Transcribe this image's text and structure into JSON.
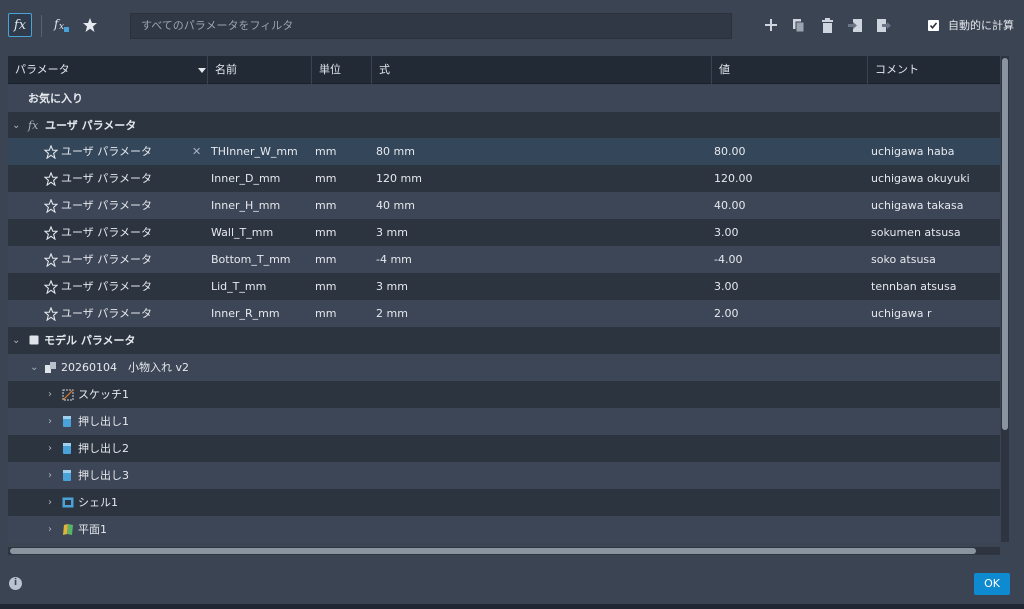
{
  "toolbar": {
    "fx_label": "fx",
    "filter_placeholder": "すべてのパラメータをフィルタ",
    "auto_compute_label": "自動的に計算",
    "auto_compute_checked": true,
    "icons": [
      "fx-icon",
      "add-favorite-parameter-icon",
      "star-icon",
      "add-icon",
      "copy-icon",
      "delete-icon",
      "import-icon",
      "export-icon"
    ]
  },
  "table": {
    "columns": [
      "パラメータ",
      "名前",
      "単位",
      "式",
      "値",
      "コメント"
    ],
    "favorites_label": "お気に入り",
    "user_params_label": "ユーザ パラメータ",
    "rows": [
      {
        "param": "ユーザ パラメータ",
        "name": "THInner_W_mm",
        "unit": "mm",
        "expr": "80 mm",
        "value": "80.00",
        "comment": "uchigawa haba"
      },
      {
        "param": "ユーザ パラメータ",
        "name": "Inner_D_mm",
        "unit": "mm",
        "expr": "120 mm",
        "value": "120.00",
        "comment": "uchigawa okuyuki"
      },
      {
        "param": "ユーザ パラメータ",
        "name": "Inner_H_mm",
        "unit": "mm",
        "expr": "40 mm",
        "value": "40.00",
        "comment": "uchigawa takasa"
      },
      {
        "param": "ユーザ パラメータ",
        "name": "Wall_T_mm",
        "unit": "mm",
        "expr": "3 mm",
        "value": "3.00",
        "comment": "sokumen atsusa"
      },
      {
        "param": "ユーザ パラメータ",
        "name": "Bottom_T_mm",
        "unit": "mm",
        "expr": "-4 mm",
        "value": "-4.00",
        "comment": "soko atsusa"
      },
      {
        "param": "ユーザ パラメータ",
        "name": "Lid_T_mm",
        "unit": "mm",
        "expr": "3 mm",
        "value": "3.00",
        "comment": "tennban atsusa"
      },
      {
        "param": "ユーザ パラメータ",
        "name": "Inner_R_mm",
        "unit": "mm",
        "expr": "2 mm",
        "value": "2.00",
        "comment": "uchigawa r"
      }
    ],
    "model_params_label": "モデル パラメータ",
    "component_label": "20260104　小物入れ v2",
    "features": [
      "スケッチ1",
      "押し出し1",
      "押し出し2",
      "押し出し3",
      "シェル1",
      "平面1"
    ]
  },
  "footer": {
    "ok_label": "OK",
    "info_label": "i"
  }
}
